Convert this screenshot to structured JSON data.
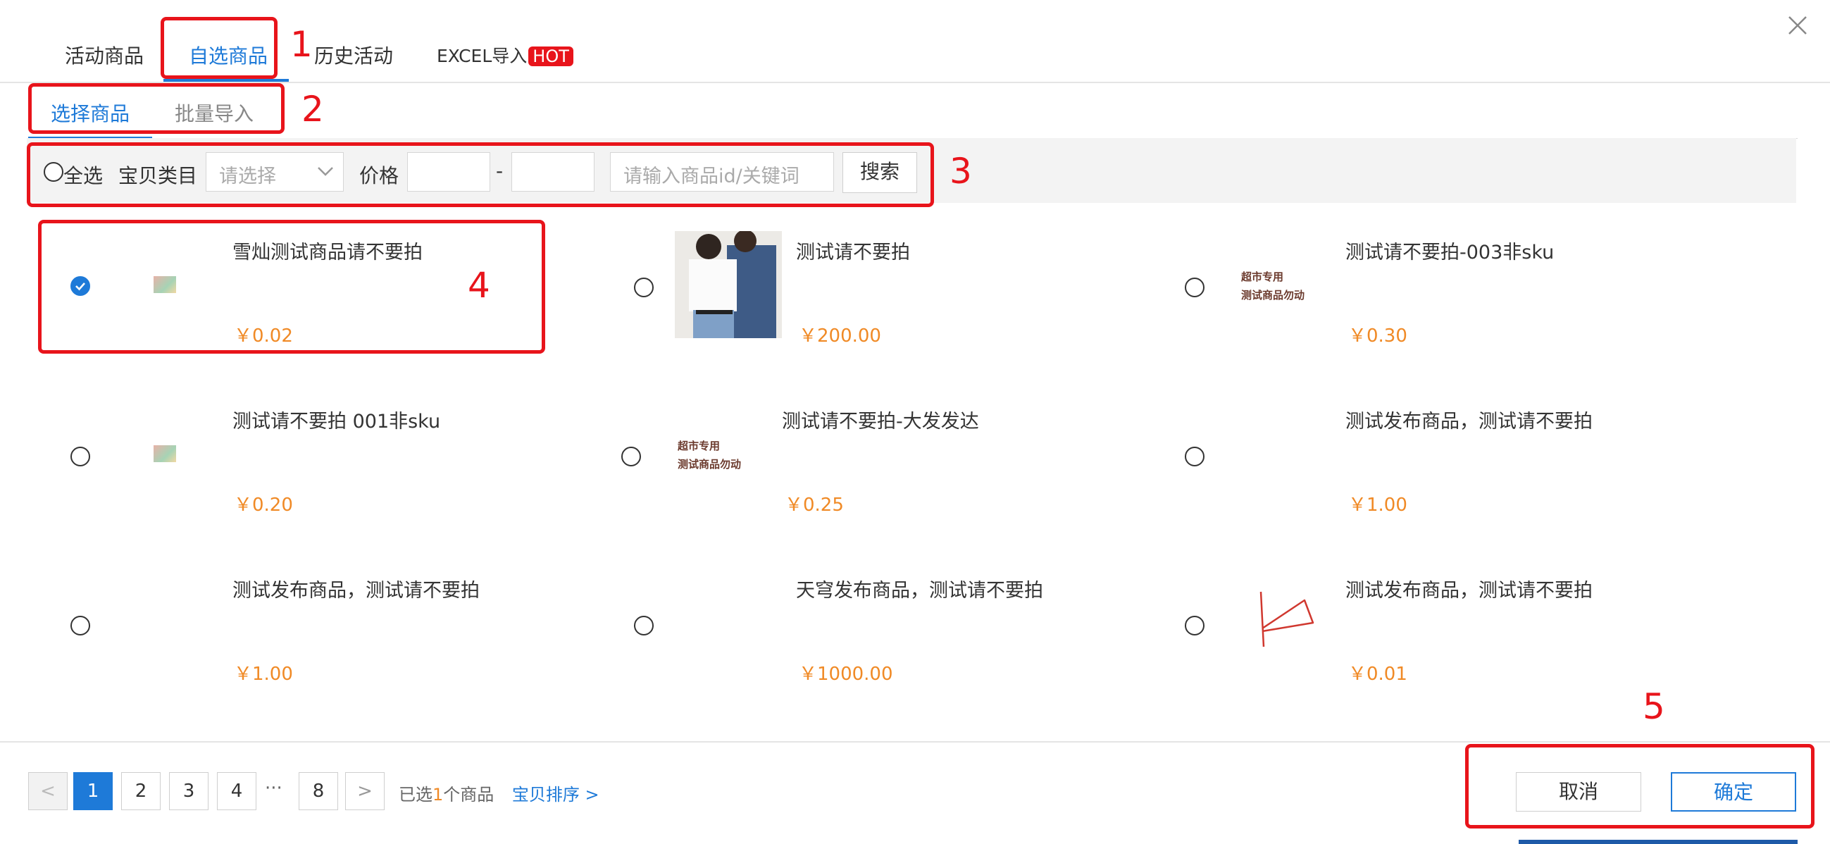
{
  "header": {
    "tabs": [
      {
        "label": "活动商品"
      },
      {
        "label": "自选商品",
        "active": true
      },
      {
        "label": "历史活动"
      },
      {
        "label": "EXCEL导入",
        "badge": "HOT"
      }
    ],
    "close_icon": "close-icon"
  },
  "sub_tabs": [
    {
      "label": "选择商品",
      "active": true
    },
    {
      "label": "批量导入"
    }
  ],
  "filter": {
    "select_all": "全选",
    "category_label": "宝贝类目",
    "category_placeholder": "请选择",
    "price_label": "价格",
    "price_sep": "-",
    "keyword_placeholder": "请输入商品id/关键词",
    "search_button": "搜索"
  },
  "products": [
    {
      "title": "雪灿测试商品请不要拍",
      "price": "￥0.02",
      "checked": true
    },
    {
      "title": "测试请不要拍",
      "price": "￥200.00"
    },
    {
      "title": "测试请不要拍-003非sku",
      "price": "￥0.30",
      "image_text": [
        "超市专用",
        "测试商品勿动"
      ]
    },
    {
      "title": "测试请不要拍 001非sku",
      "price": "￥0.20"
    },
    {
      "title": "测试请不要拍-大发发达",
      "price": "￥0.25",
      "image_text": [
        "超市专用",
        "测试商品勿动"
      ]
    },
    {
      "title": "测试发布商品，测试请不要拍",
      "price": "￥1.00"
    },
    {
      "title": "测试发布商品，测试请不要拍",
      "price": "￥1.00"
    },
    {
      "title": "天穹发布商品，测试请不要拍",
      "price": "￥1000.00"
    },
    {
      "title": "测试发布商品，测试请不要拍",
      "price": "￥0.01"
    }
  ],
  "pagination": {
    "prev": "<",
    "pages": [
      "1",
      "2",
      "3",
      "4"
    ],
    "ellipsis": "···",
    "last": "8",
    "next": ">",
    "current": "1"
  },
  "selection": {
    "prefix": "已选",
    "count": "1",
    "suffix": "个商品",
    "sort_link": "宝贝排序 >"
  },
  "footer": {
    "cancel": "取消",
    "confirm": "确定"
  },
  "annotations": [
    "1",
    "2",
    "3",
    "4",
    "5"
  ],
  "colors": {
    "accent": "#1e7ad8",
    "price": "#f08a26",
    "annotation": "#e8141b"
  }
}
